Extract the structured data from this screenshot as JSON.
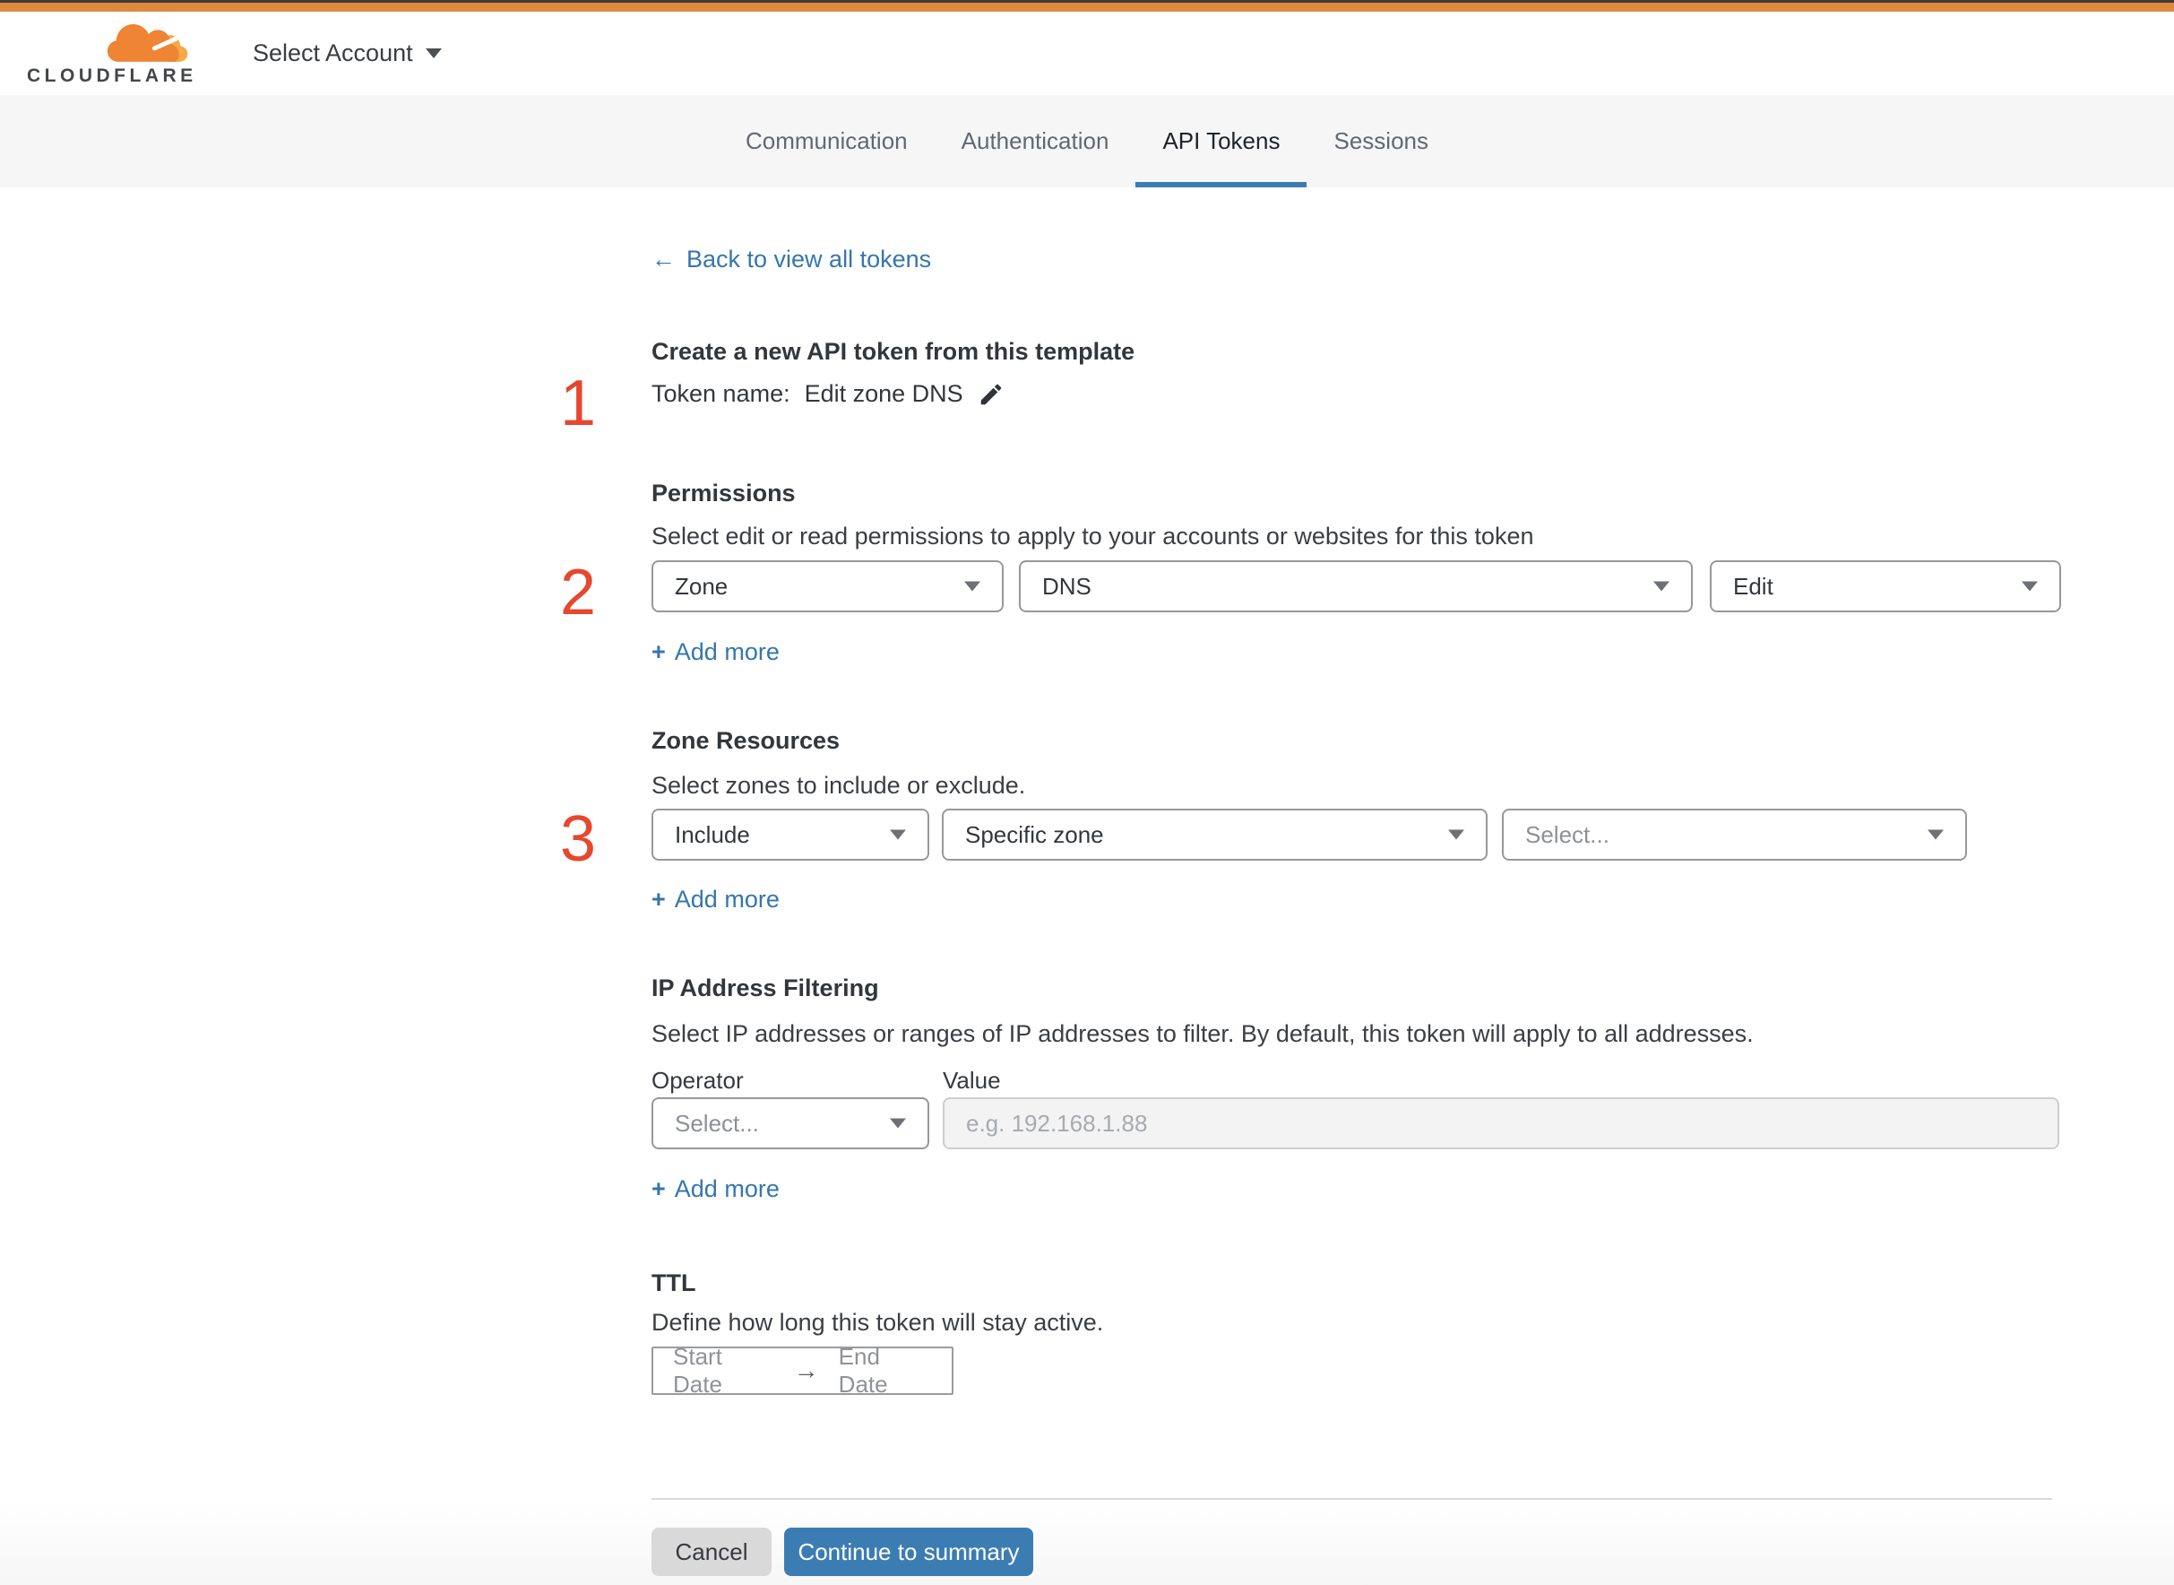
{
  "colors": {
    "topbar_orange": "#dd8a3f",
    "topbar_dark": "#3f3b37",
    "brand_cloud": "#ee8434",
    "brand_cloud_light": "#f6ab47",
    "link_blue": "#3576ad",
    "accent_blue": "#3b7db3",
    "step_red": "#e5472f"
  },
  "header": {
    "logo_text": "CLOUDFLARE",
    "account_selector_label": "Select Account"
  },
  "tabs": [
    {
      "label": "Communication"
    },
    {
      "label": "Authentication"
    },
    {
      "label": "API Tokens"
    },
    {
      "label": "Sessions"
    }
  ],
  "back": {
    "arrow": "←",
    "label": "Back to view all tokens"
  },
  "template_intro": {
    "step": "1",
    "title": "Create a new API token from this template",
    "token_name_prefix": "Token name:",
    "token_name": "Edit zone DNS"
  },
  "permissions": {
    "step": "2",
    "title": "Permissions",
    "description": "Select edit or read permissions to apply to your accounts or websites for this token",
    "scope_value": "Zone",
    "resource_value": "DNS",
    "access_value": "Edit",
    "add_more_label": "Add more"
  },
  "zone_resources": {
    "step": "3",
    "title": "Zone Resources",
    "description": "Select zones to include or exclude.",
    "mode_value": "Include",
    "type_value": "Specific zone",
    "zone_value": "Select...",
    "add_more_label": "Add more"
  },
  "ip_filtering": {
    "title": "IP Address Filtering",
    "description": "Select IP addresses or ranges of IP addresses to filter. By default, this token will apply to all addresses.",
    "operator_label": "Operator",
    "value_label": "Value",
    "operator_value": "Select...",
    "value_placeholder": "e.g. 192.168.1.88",
    "add_more_label": "Add more"
  },
  "ttl": {
    "title": "TTL",
    "description": "Define how long this token will stay active.",
    "start_label": "Start Date",
    "arrow": "→",
    "end_label": "End Date"
  },
  "footer": {
    "cancel_label": "Cancel",
    "continue_label": "Continue to summary"
  },
  "icons": {
    "plus": "+"
  }
}
